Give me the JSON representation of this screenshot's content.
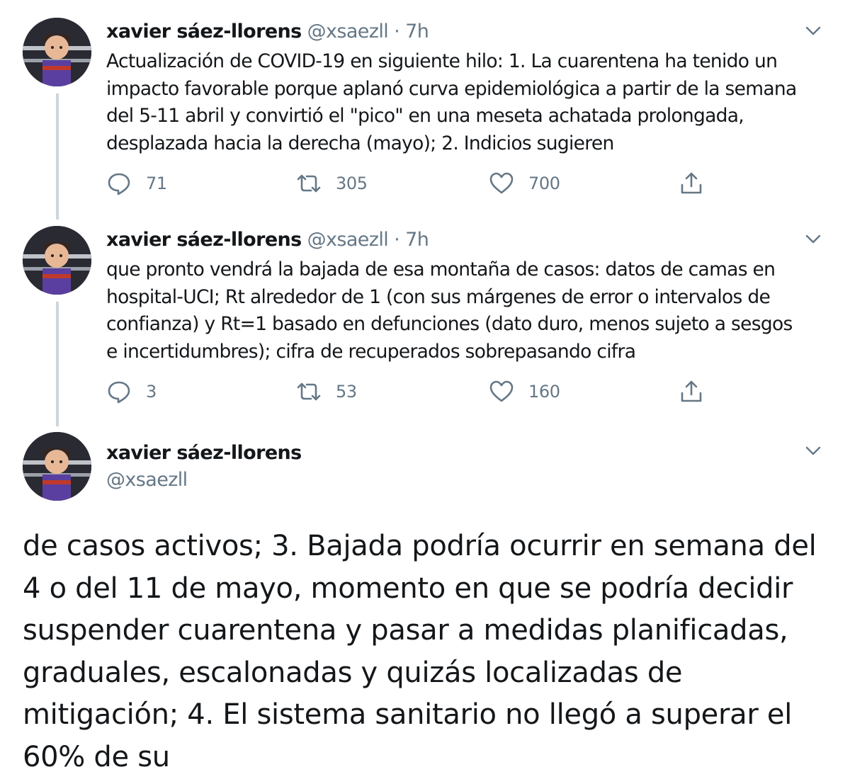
{
  "tweets": [
    {
      "name": "xavier sáez-llorens",
      "handle": "@xsaezll",
      "dot": "·",
      "time": "7h",
      "text_lines": [
        "Actualización de COVID-19 en siguiente hilo: 1. La cuarentena ha tenido un",
        "impacto favorable porque aplanó curva epidemiológica a partir de la semana",
        "del 5-11 abril y convirtió el \"pico\" en una meseta achatada prolongada,",
        "desplazada hacia la derecha (mayo); 2. Indicios sugieren"
      ],
      "replies": "71",
      "retweets": "305",
      "likes": "700"
    },
    {
      "name": "xavier sáez-llorens",
      "handle": "@xsaezll",
      "dot": "·",
      "time": "7h",
      "text_lines": [
        "que pronto vendrá la bajada de esa montaña de casos: datos de camas en",
        "hospital-UCI; Rt alrededor de 1 (con sus márgenes de error o intervalos de",
        "confianza) y Rt=1 basado en defunciones (dato duro, menos sujeto a sesgos",
        "e incertidumbres); cifra de recuperados sobrepasando cifra"
      ],
      "replies": "3",
      "retweets": "53",
      "likes": "160"
    }
  ],
  "focused_tweet": {
    "name": "xavier sáez-llorens",
    "handle": "@xsaezll",
    "text_lines": [
      "de casos activos; 3. Bajada podría ocurrir en semana del",
      "4 o del 11 de mayo, momento en que se podría decidir",
      "suspender cuarentena y pasar a medidas planificadas,",
      "graduales, escalonadas y quizás localizadas de",
      "mitigación; 4. El sistema sanitario no llegó a superar el",
      "60% de su"
    ]
  },
  "icons": {
    "reply": "reply-icon",
    "retweet": "retweet-icon",
    "like": "heart-icon",
    "share": "share-icon",
    "caret": "chevron-down-icon"
  },
  "colors": {
    "text": "#14171a",
    "secondary": "#657786",
    "thread_line": "#ccd6dd"
  }
}
